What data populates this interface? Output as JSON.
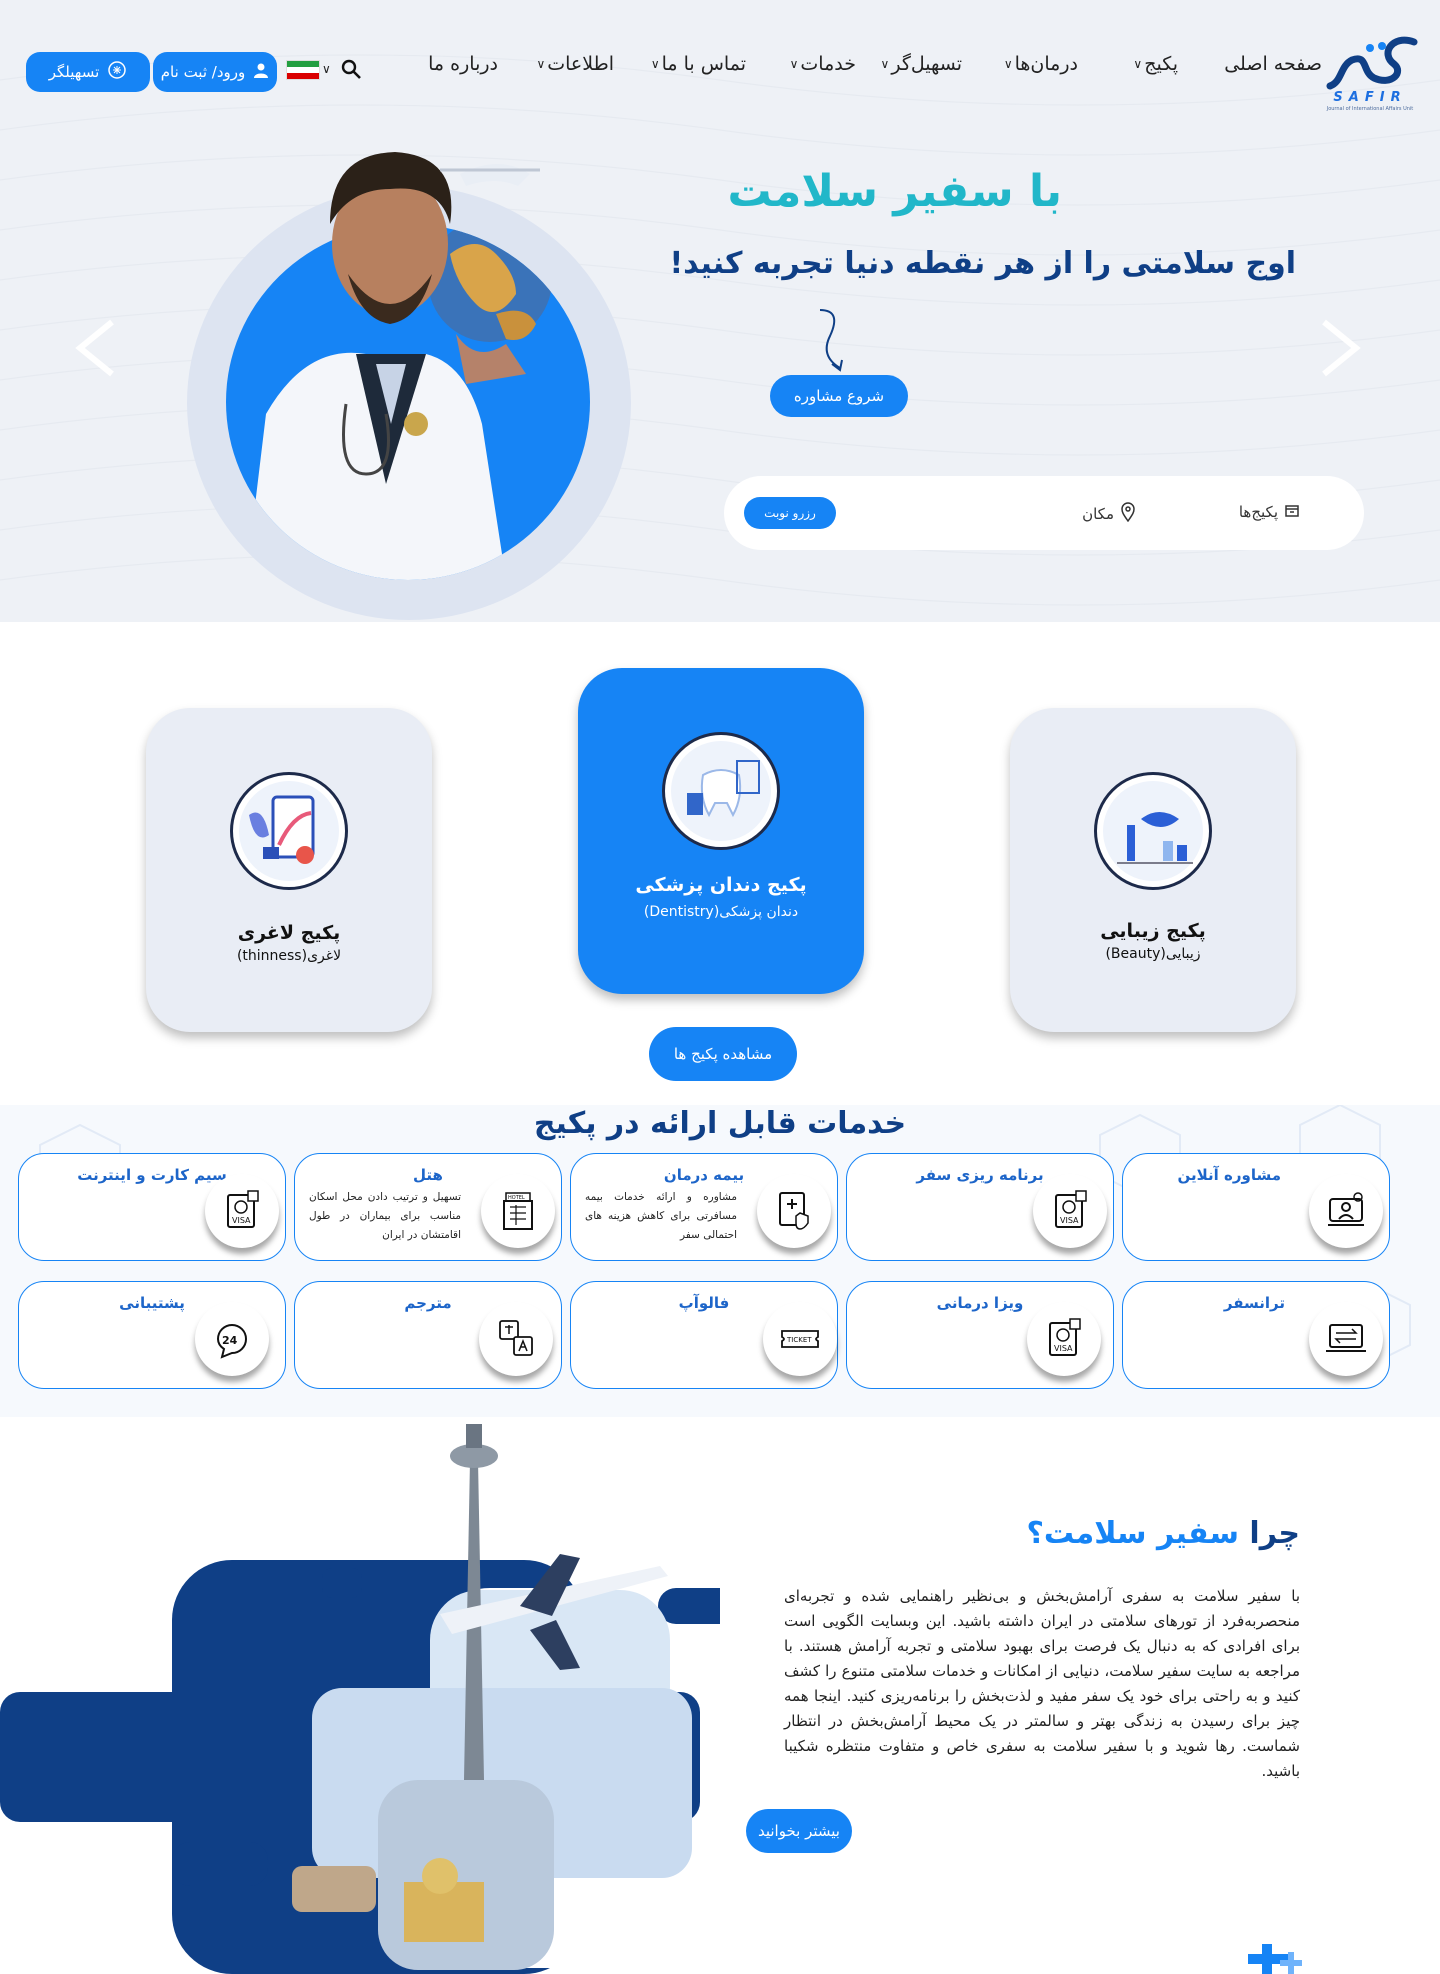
{
  "brand": {
    "logo_text": "SAFIR",
    "logo_sub": "Journal of International Affairs Unit",
    "color": "#1684f5"
  },
  "nav": {
    "items": [
      {
        "label": "صفحه اصلی",
        "dropdown": false
      },
      {
        "label": "پکیج",
        "dropdown": true
      },
      {
        "label": "درمان‌ها",
        "dropdown": true
      },
      {
        "label": "تسهیل‌گر",
        "dropdown": true
      },
      {
        "label": "خدمات",
        "dropdown": true
      },
      {
        "label": "تماس با ما",
        "dropdown": true
      },
      {
        "label": "اطلاعات",
        "dropdown": true
      },
      {
        "label": "درباره ما",
        "dropdown": false
      }
    ],
    "login_label": "ورود/ ثبت نام",
    "facilitator_label": "تسهیلگر"
  },
  "hero": {
    "title": "با سفیر سلامت",
    "subtitle": "اوج سلامتی را از هر نقطه دنیا تجربه کنید!",
    "cta_label": "شروع مشاوره",
    "search": {
      "packages_label": "پکیج‌ها",
      "location_label": "مکان",
      "reserve_label": "رزرو نوبت"
    }
  },
  "packages": {
    "cards": [
      {
        "title": "پکیج  زیبایی",
        "subtitle": "زیبایی(Beauty)"
      },
      {
        "title": "پکیج دندان پزشکی",
        "subtitle": "دندان پزشکی(Dentistry)"
      },
      {
        "title": "پکیج لاغری",
        "subtitle": "لاغری(thinness)"
      }
    ],
    "view_all_label": "مشاهده پکیج ها"
  },
  "services": {
    "title": "خدمات قابل ارائه در پکیج",
    "row1": [
      {
        "title": "مشاوره آنلاین",
        "desc": "",
        "icon": "online-consult-icon"
      },
      {
        "title": "برنامه ریزی سفر",
        "desc": "",
        "icon": "visa-icon"
      },
      {
        "title": "بیمه درمان",
        "desc": "مشاوره و ارائه خدمات بیمه مسافرتی برای کاهش هزینه های احتمالی سفر",
        "icon": "insurance-icon"
      },
      {
        "title": "هتل",
        "desc": "تسهیل و ترتیب دادن محل اسکان مناسب برای بیماران در طول اقامتشان در ایران",
        "icon": "hotel-icon"
      },
      {
        "title": "سیم کارت و اینترنت",
        "desc": "",
        "icon": "visa-icon"
      }
    ],
    "row2": [
      {
        "title": "ترانسفر",
        "icon": "transfer-icon"
      },
      {
        "title": "ویزا درمانی",
        "icon": "visa-icon"
      },
      {
        "title": "فالوآپ",
        "icon": "ticket-icon"
      },
      {
        "title": "مترجم",
        "icon": "translate-icon"
      },
      {
        "title": "پشتیبانی",
        "icon": "support-24-icon"
      }
    ]
  },
  "why": {
    "title_dark": "چرا",
    "title_blue": "سفیر سلامت؟",
    "text": "با سفیر سلامت به سفری آرامش‌بخش و بی‌نظیر راهنمایی شده و تجربه‌ای منحصربه‌فرد از تورهای سلامتی در ایران داشته باشید. این وبسایت الگویی است برای افرادی که به دنبال یک فرصت برای بهبود سلامتی و تجربه آرامش هستند. با مراجعه به سایت سفیر سلامت، دنیایی از امکانات و خدمات سلامتی متنوع را کشف کنید و به راحتی برای خود یک سفر مفید و لذت‌بخش را برنامه‌ریزی کنید. اینجا همه چیز برای رسیدن به زندگی بهتر و سالمتر در یک محیط آرامش‌بخش در انتظار شماست. رها شوید و با سفیر سلامت به سفری خاص و متفاوت منتظره شکیبا باشید.",
    "more_label": "بیشتر بخوانید"
  },
  "ui": {
    "ticket_text": "TICKET",
    "visa_text": "VISA",
    "hotel_text": "HOTEL"
  }
}
